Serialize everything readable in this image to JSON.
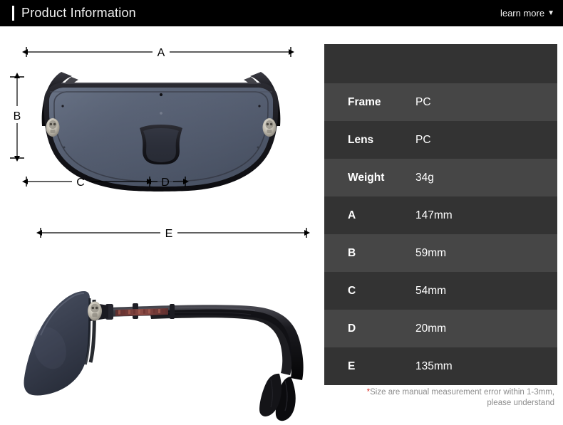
{
  "header": {
    "title": "Product Information",
    "learn_more_label": "learn more",
    "caret_icon": "chevron-down-icon",
    "background_color": "#000000",
    "accent_color": "#ffffff"
  },
  "diagram": {
    "front_view": {
      "alt": "sunglasses-front-view",
      "lens_color": "#555f72",
      "frame_color": "#1a1a1f",
      "ornament_color": "#c9c6bd",
      "dimension_labels": [
        "A",
        "B",
        "C",
        "D"
      ]
    },
    "side_view": {
      "alt": "sunglasses-side-view",
      "lens_color": "#3c4250",
      "frame_color": "#121214",
      "temple_inlay_color": "#7a3a3a",
      "ornament_color": "#c9c6bd",
      "dimension_labels": [
        "E"
      ]
    },
    "labels": {
      "a": "A",
      "b": "B",
      "c": "C",
      "d": "D",
      "e": "E"
    },
    "line_color": "#000000"
  },
  "spec_table": {
    "rows": [
      {
        "label": "Frame",
        "value": "PC"
      },
      {
        "label": "Lens",
        "value": "PC"
      },
      {
        "label": "Weight",
        "value": "34g"
      },
      {
        "label": "A",
        "value": "147mm"
      },
      {
        "label": "B",
        "value": "59mm"
      },
      {
        "label": "C",
        "value": "54mm"
      },
      {
        "label": "D",
        "value": "20mm"
      },
      {
        "label": "E",
        "value": "135mm"
      }
    ],
    "row_color_light": "#464646",
    "row_color_dark": "#333333"
  },
  "note": {
    "asterisk": "*",
    "line1": "Size are manual measurement error within 1-3mm,",
    "line2": "please understand",
    "asterisk_color": "#d9352c"
  }
}
